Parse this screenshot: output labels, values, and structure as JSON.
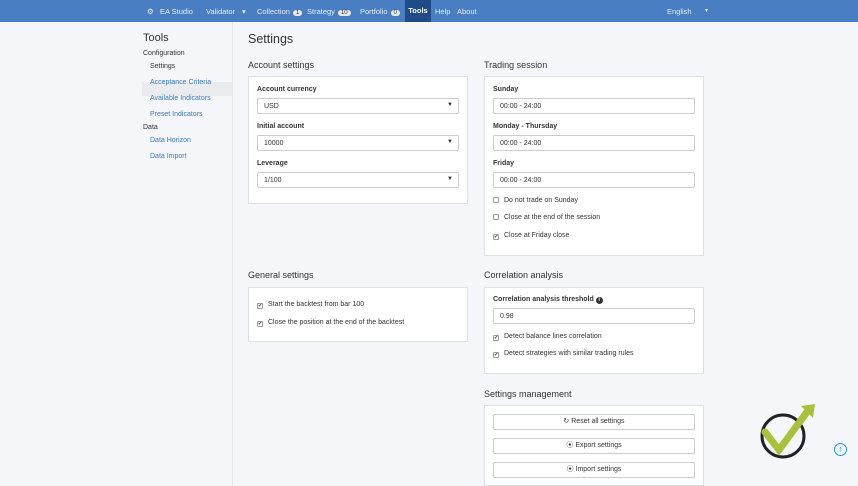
{
  "nav": {
    "brand": "EA Studio",
    "validator": "Validator",
    "validator_caret": "▾",
    "collection": "Collection",
    "collection_badge": "1",
    "strategy": "Strategy",
    "strategy_badge": "10",
    "portfolio": "Portfolio",
    "portfolio_badge": "0",
    "tools": "Tools",
    "help": "Help",
    "about": "About",
    "language": "English",
    "language_caret": "▾"
  },
  "sidebar": {
    "title": "Tools",
    "groups": [
      {
        "label": "Configuration"
      },
      {
        "label": "Data"
      }
    ],
    "items": [
      {
        "label": "Settings"
      },
      {
        "label": "Acceptance Criteria"
      },
      {
        "label": "Available Indicators"
      },
      {
        "label": "Preset Indicators"
      },
      {
        "label": "Data Horizon"
      },
      {
        "label": "Data Import"
      }
    ]
  },
  "page_title": "Settings",
  "account": {
    "title": "Account settings",
    "currency_label": "Account currency",
    "currency": "USD",
    "initial_label": "Initial account",
    "initial": "10000",
    "leverage_label": "Leverage",
    "leverage": "1/100"
  },
  "session": {
    "title": "Trading session",
    "sunday_label": "Sunday",
    "sunday": "00:00 - 24:00",
    "mt_label": "Monday - Thursday",
    "mt": "00:00 - 24:00",
    "friday_label": "Friday",
    "friday": "00:00 - 24:00",
    "checks": [
      {
        "label": "Do not trade on Sunday",
        "checked": false
      },
      {
        "label": "Close at the end of the session",
        "checked": false
      },
      {
        "label": "Close at Friday close",
        "checked": true
      }
    ]
  },
  "general": {
    "title": "General settings",
    "checks": [
      {
        "label": "Start the backtest from bar 100",
        "checked": true
      },
      {
        "label": "Close the position at the end of the backtest",
        "checked": true
      }
    ]
  },
  "correlation": {
    "title": "Correlation analysis",
    "threshold_label": "Correlation analysis threshold",
    "threshold": "0.98",
    "checks": [
      {
        "label": "Detect balance lines correlation",
        "checked": true
      },
      {
        "label": "Detect strategies with similar trading rules",
        "checked": true
      }
    ]
  },
  "management": {
    "title": "Settings management",
    "reset": "Reset all settings",
    "export": "Export settings",
    "import": "Import settings"
  },
  "colors": {
    "nav": "#4a7ec2",
    "active": "#1f4c86",
    "link": "#3a78c2",
    "logo_green": "#a6c23a"
  }
}
